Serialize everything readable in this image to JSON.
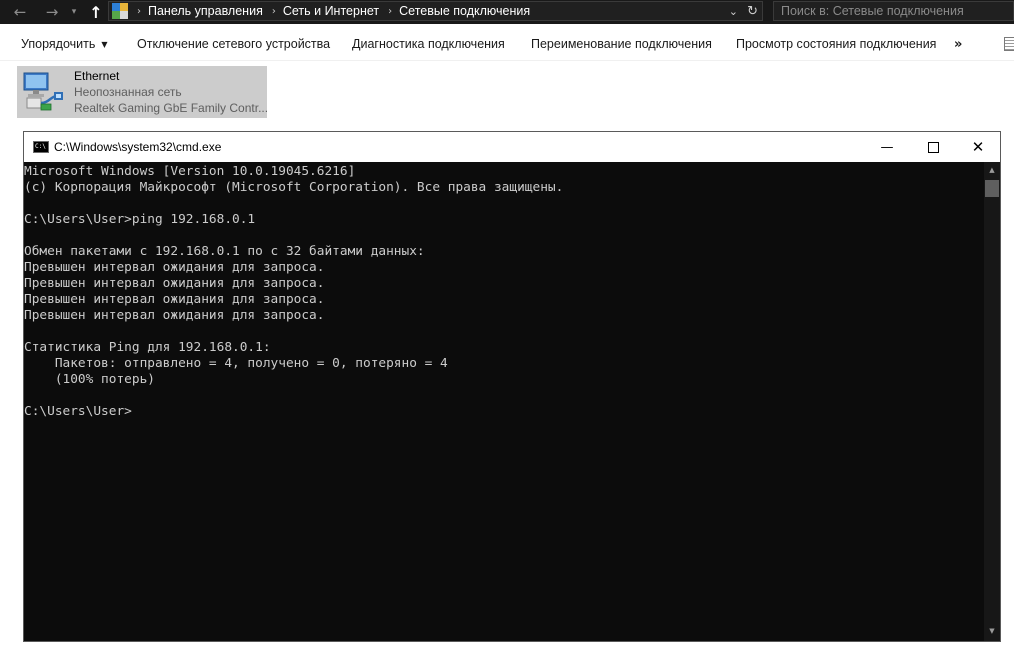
{
  "explorer": {
    "breadcrumbs": [
      "Панель управления",
      "Сеть и Интернет",
      "Сетевые подключения"
    ],
    "search_placeholder": "Поиск в: Сетевые подключения",
    "toolbar": {
      "organize": "Упорядочить",
      "disable": "Отключение сетевого устройства",
      "diagnose": "Диагностика подключения",
      "rename": "Переименование подключения",
      "status": "Просмотр состояния подключения",
      "more": "»"
    },
    "connection": {
      "name": "Ethernet",
      "status": "Неопознанная сеть",
      "device": "Realtek Gaming GbE Family Contr..."
    }
  },
  "cmd": {
    "title": "C:\\Windows\\system32\\cmd.exe",
    "icon_label": "C:\\",
    "output": "Microsoft Windows [Version 10.0.19045.6216]\n(c) Корпорация Майкрософт (Microsoft Corporation). Все права защищены.\n\nC:\\Users\\User>ping 192.168.0.1\n\nОбмен пакетами с 192.168.0.1 по с 32 байтами данных:\nПревышен интервал ожидания для запроса.\nПревышен интервал ожидания для запроса.\nПревышен интервал ожидания для запроса.\nПревышен интервал ожидания для запроса.\n\nСтатистика Ping для 192.168.0.1:\n    Пакетов: отправлено = 4, получено = 0, потеряно = 4\n    (100% потерь)\n\nC:\\Users\\User>"
  }
}
